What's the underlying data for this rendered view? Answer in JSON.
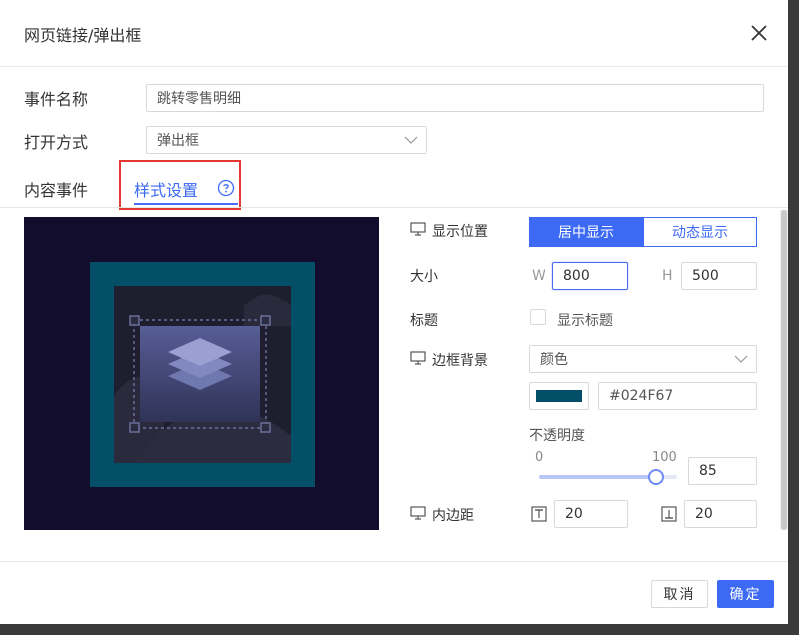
{
  "dialog": {
    "title": "网页链接/弹出框"
  },
  "form": {
    "event_name_label": "事件名称",
    "event_name_value": "跳转零售明细",
    "open_mode_label": "打开方式",
    "open_mode_value": "弹出框"
  },
  "tabs": [
    {
      "label": "内容事件",
      "active": false
    },
    {
      "label": "样式设置",
      "active": true
    }
  ],
  "settings": {
    "display_position_label": "显示位置",
    "display_options": [
      "居中显示",
      "动态显示"
    ],
    "size_label": "大小",
    "width_letter": "W",
    "width_value": "800",
    "height_letter": "H",
    "height_value": "500",
    "title_label": "标题",
    "show_title_label": "显示标题",
    "border_bg_label": "边框背景",
    "border_bg_type": "颜色",
    "color_hex": "#024F67",
    "color_swatch": "#024f67",
    "opacity_label": "不透明度",
    "opacity_min": "0",
    "opacity_max": "100",
    "opacity_value": "85",
    "opacity_fraction": 0.85,
    "padding_label": "内边距",
    "padding_top": "20",
    "padding_bottom": "20"
  },
  "footer": {
    "cancel_label": "取消",
    "ok_label": "确定"
  },
  "colors": {
    "accent": "#3d6af5",
    "highlight_border": "#e53935",
    "preview_bg": "#130d2d",
    "frame_color": "#024f67"
  },
  "icons": {
    "close": "close-icon",
    "help": "question-circle-icon",
    "monitor": "monitor-icon",
    "chevron": "chevron-down-icon",
    "padding_top": "padding-top-icon",
    "padding_bottom": "padding-bottom-icon"
  }
}
